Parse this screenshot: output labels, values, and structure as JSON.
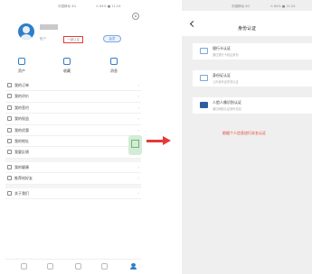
{
  "left_screen": {
    "status_bar": {
      "signal": "中国移动 4G",
      "battery": "⊙ 84% ■ 11:24"
    },
    "profile": {
      "sub_label": "账户",
      "verify_button": "一键认证",
      "member_label": "会员"
    },
    "quick_actions": [
      {
        "label": "资产",
        "icon": "wallet-icon"
      },
      {
        "label": "收藏",
        "icon": "star-icon"
      },
      {
        "label": "消息",
        "icon": "message-icon"
      }
    ],
    "menu_groups": [
      [
        "我的订单",
        "我的评价",
        "我的签约",
        "我的权益",
        "我的优惠",
        "我的地址",
        "我要反馈"
      ],
      [
        "我的健康",
        "推荐给好友"
      ],
      [
        "关于我们"
      ]
    ],
    "tab_bar": [
      {
        "icon": "home-icon"
      },
      {
        "icon": "heart-icon"
      },
      {
        "icon": "service-icon"
      },
      {
        "icon": "mail-icon"
      },
      {
        "icon": "person-icon"
      }
    ]
  },
  "right_screen": {
    "status_bar": {
      "signal": "中国移动 4G",
      "battery": "⊙ 84% ■ 11:24"
    },
    "nav_title": "身份认证",
    "cards": [
      {
        "title": "银行卡认证",
        "subtitle": "通过银行卡验证身份"
      },
      {
        "title": "身份证认证",
        "subtitle": "上传身份证完成认证"
      },
      {
        "title": "人脸人像识别认证",
        "subtitle": "通过刷脸认证身份信息"
      }
    ],
    "hint_text": "根据个人信息进行实名认证"
  },
  "colors": {
    "accent": "#e53935",
    "brand": "#2f7ec8",
    "page_bg": "#efefef"
  }
}
